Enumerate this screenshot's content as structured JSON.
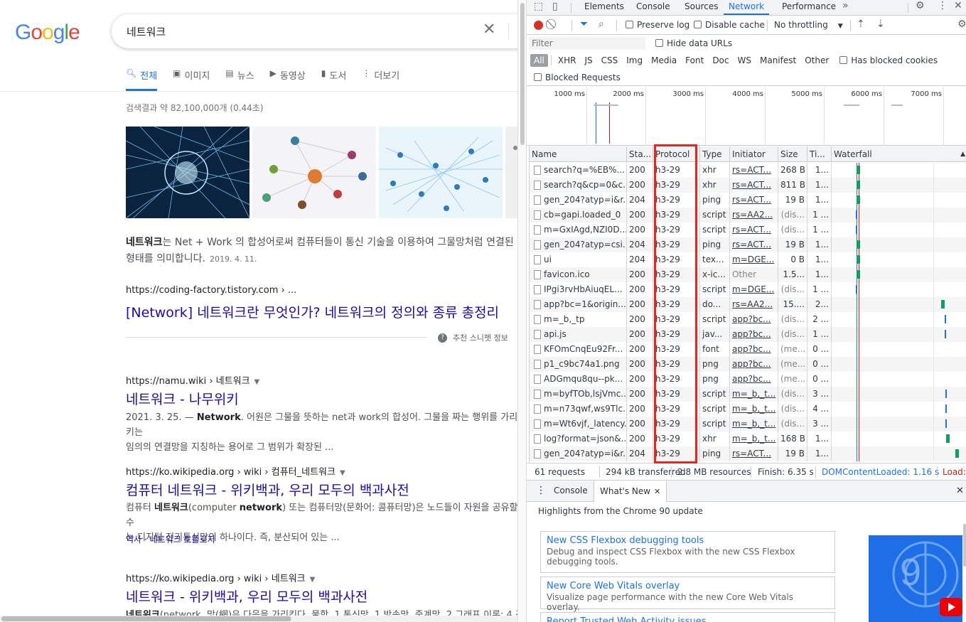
{
  "google": {
    "search": {
      "query": "네트워크"
    },
    "tabs": [
      {
        "icon": "search-icon",
        "label": "전체",
        "active": true
      },
      {
        "icon": "image-icon",
        "label": "이미지"
      },
      {
        "icon": "news-icon",
        "label": "뉴스"
      },
      {
        "icon": "video-icon",
        "label": "동영상"
      },
      {
        "icon": "book-icon",
        "label": "도서"
      },
      {
        "icon": "more-icon",
        "label": "더보기"
      }
    ],
    "stats": "검색결과 약 82,100,000개 (0.44초)",
    "snippet": {
      "bold": "네트워크",
      "text1": "는 Net + Work 의 합성어로써 컴퓨터들이 통신 기술을 이용하여 그물망처럼 연결된",
      "text2": "형태를 의미합니다.",
      "date": "2019. 4. 11.",
      "cite": "https://coding-factory.tistory.com › ...",
      "title": "[Network] 네트워크란 무엇인가? 네트워크의 정의와 종류 총정리",
      "feedback": "추천 스니펫 정보"
    },
    "results": [
      {
        "cite": "https://namu.wiki › 네트워크",
        "title": "네트워크 - 나무위키",
        "desc1_pre": "2021. 3. 25. — ",
        "desc1_bold": "Network",
        "desc1_post": ". 어원은 그물을 뜻하는 net과 work의 합성어. 그물을 짜는 행위를 가리키는",
        "desc2": "임의의 연결망을 지칭하는 용어로 그 범위가 확장된 ..."
      },
      {
        "cite": "https://ko.wikipedia.org › wiki › 컴퓨터_네트워크",
        "title": "컴퓨터 네트워크 - 위키백과, 우리 모두의 백과사전",
        "desc1_pre": "컴퓨터 ",
        "desc1_bold": "네트워크",
        "desc1_mid": "(computer ",
        "desc1_bold2": "network",
        "desc1_post": ") 또는 컴퓨터망(문화어: 콤퓨터망)은 노드들이 자원을 공유할 수",
        "desc2": "는 디지털 전기통신망의 하나이다. 즉, 분산되어 있는 ...",
        "sublinks": "역사 · 네트워크 토폴로지"
      },
      {
        "cite": "https://ko.wikipedia.org › wiki › 네트워크",
        "title": "네트워크 - 위키백과, 우리 모두의 백과사전",
        "desc1_bold": "네트워크",
        "desc1_post": "(network, 망(網)은 다음을 가리킨다. 물학, 1 통신망, 1 방송망, 중계망, 2 그래프 이론: 4 경"
      }
    ]
  },
  "devtools": {
    "tabs": [
      "Elements",
      "Console",
      "Sources",
      "Network",
      "Performance"
    ],
    "active_tab": "Network",
    "toolbar": {
      "preserve_log": "Preserve log",
      "disable_cache": "Disable cache",
      "throttling": "No throttling"
    },
    "filter": {
      "placeholder": "Filter",
      "hide_data_urls": "Hide data URLs",
      "blocked_requests": "Blocked Requests",
      "has_blocked_cookies": "Has blocked cookies"
    },
    "filter_types": [
      "All",
      "XHR",
      "JS",
      "CSS",
      "Img",
      "Media",
      "Font",
      "Doc",
      "WS",
      "Manifest",
      "Other"
    ],
    "timeline_ticks": [
      "1000 ms",
      "2000 ms",
      "3000 ms",
      "4000 ms",
      "5000 ms",
      "6000 ms",
      "7000 ms"
    ],
    "columns": [
      "Name",
      "Sta...",
      "Protocol",
      "Type",
      "Initiator",
      "Size",
      "Ti...",
      "Waterfall"
    ],
    "rows": [
      {
        "name": "search?q=%EB%...",
        "status": "200",
        "protocol": "h3-29",
        "type": "xhr",
        "initiator": "rs=ACT...",
        "size": "268 B",
        "time": "1...",
        "wf": 0.19,
        "color": "#0fa061"
      },
      {
        "name": "search?q&cp=0&c...",
        "status": "200",
        "protocol": "h3-29",
        "type": "xhr",
        "initiator": "rs=ACT...",
        "size": "811 B",
        "time": "1...",
        "wf": 0.19,
        "color": "#0fa061"
      },
      {
        "name": "gen_204?atyp=i&r...",
        "status": "204",
        "protocol": "h3-29",
        "type": "ping",
        "initiator": "rs=ACT...",
        "size": "19 B",
        "time": "1...",
        "wf": 0.19,
        "color": "#0fa061"
      },
      {
        "name": "cb=gapi.loaded_0",
        "status": "200",
        "protocol": "h3-29",
        "type": "script",
        "initiator": "rs=AA2...",
        "size": "(dis...",
        "time": "1 ...",
        "wf": 0.185,
        "color": "#1a73e8"
      },
      {
        "name": "m=GxIAgd,NZI0D...",
        "status": "200",
        "protocol": "h3-29",
        "type": "script",
        "initiator": "rs=ACT...",
        "size": "(dis...",
        "time": "1 ...",
        "wf": 0.185,
        "color": "#1a73e8"
      },
      {
        "name": "gen_204?atyp=csi...",
        "status": "204",
        "protocol": "h3-29",
        "type": "ping",
        "initiator": "rs=ACT...",
        "size": "19 B",
        "time": "1...",
        "wf": 0.19,
        "color": "#0fa061"
      },
      {
        "name": "ui",
        "status": "204",
        "protocol": "h3-29",
        "type": "tex...",
        "initiator": "m=DGE...",
        "size": "0 B",
        "time": "1...",
        "wf": 0.19,
        "color": "#0fa061"
      },
      {
        "name": "favicon.ico",
        "status": "200",
        "protocol": "h3-29",
        "type": "x-ic...",
        "initiator": "Other",
        "size": "1.5...",
        "time": "1...",
        "wf": 0.19,
        "color": "#0fa061"
      },
      {
        "name": "IPgi3rvHbAiuqEL...",
        "status": "200",
        "protocol": "h3-29",
        "type": "script",
        "initiator": "m=DGE...",
        "size": "(dis...",
        "time": "1 ...",
        "wf": 0.185,
        "color": "#1a73e8"
      },
      {
        "name": "app?bc=1&origin...",
        "status": "200",
        "protocol": "h3-29",
        "type": "do...",
        "initiator": "rs=AA2...",
        "size": "15....",
        "time": "2...",
        "wf": 0.83,
        "color": "#0fa061"
      },
      {
        "name": "m=_b,_tp",
        "status": "200",
        "protocol": "h3-29",
        "type": "script",
        "initiator": "app?bc...",
        "size": "(dis...",
        "time": "2 ...",
        "wf": 0.855,
        "color": "#1a73e8"
      },
      {
        "name": "api.js",
        "status": "200",
        "protocol": "h3-29",
        "type": "jav...",
        "initiator": "app?bc...",
        "size": "(dis...",
        "time": "1 ...",
        "wf": 0.855,
        "color": "#1a73e8"
      },
      {
        "name": "KFOmCnqEu92Fr...",
        "status": "200",
        "protocol": "h3-29",
        "type": "font",
        "initiator": "app?bc...",
        "size": "(me...",
        "time": "0 ...",
        "wf": null,
        "color": ""
      },
      {
        "name": "p1_c9bc74a1.png",
        "status": "200",
        "protocol": "h3-29",
        "type": "png",
        "initiator": "app?bc...",
        "size": "(me...",
        "time": "0 ...",
        "wf": null,
        "color": ""
      },
      {
        "name": "ADGmqu8qu--pk...",
        "status": "200",
        "protocol": "h3-29",
        "type": "png",
        "initiator": "app?bc...",
        "size": "(me...",
        "time": "0 ...",
        "wf": null,
        "color": ""
      },
      {
        "name": "m=byfTOb,lsjVmc...",
        "status": "200",
        "protocol": "h3-29",
        "type": "script",
        "initiator": "m=_b,_t...",
        "size": "(dis...",
        "time": "3 ...",
        "wf": 0.86,
        "color": "#1a73e8"
      },
      {
        "name": "m=n73qwf,ws9Tlc...",
        "status": "200",
        "protocol": "h3-29",
        "type": "script",
        "initiator": "m=_b,_t...",
        "size": "(dis...",
        "time": "4 ...",
        "wf": 0.86,
        "color": "#1a73e8"
      },
      {
        "name": "m=Wt6vjf,_latency...",
        "status": "200",
        "protocol": "h3-29",
        "type": "script",
        "initiator": "m=_b,_t...",
        "size": "(dis...",
        "time": "3 ...",
        "wf": 0.86,
        "color": "#1a73e8"
      },
      {
        "name": "log?format=json&...",
        "status": "200",
        "protocol": "h3-29",
        "type": "xhr",
        "initiator": "m=_b,_t...",
        "size": "168 B",
        "time": "1...",
        "wf": 0.865,
        "color": "#0fa061"
      },
      {
        "name": "gen_204?atyp=i&r...",
        "status": "204",
        "protocol": "h3-29",
        "type": "ping",
        "initiator": "rs=ACT...",
        "size": "19 B",
        "time": "1...",
        "wf": 0.935,
        "color": "#0fa061"
      }
    ],
    "status": {
      "requests": "61 requests",
      "transferred": "294 kB transferred",
      "resources": "2.8 MB resources",
      "finish": "Finish: 6.35 s",
      "domcontentloaded": "DOMContentLoaded: 1.16 s",
      "load": "Load:"
    },
    "drawer": {
      "tabs": [
        "Console",
        "What's New"
      ],
      "active": "What's New",
      "highlight": "Highlights from the Chrome 90 update",
      "cards": [
        {
          "title": "New CSS Flexbox debugging tools",
          "desc": "Debug and inspect CSS Flexbox with the new CSS Flexbox debugging tools."
        },
        {
          "title": "New Core Web Vitals overlay",
          "desc": "Visualize page performance with the new Core Web Vitals overlay."
        },
        {
          "title": "Report Trusted Web Activity issues",
          "desc": ""
        }
      ]
    },
    "colors": {
      "accent": "#1a73e8",
      "record": "#d93025",
      "highlight_box": "#e8261f",
      "green": "#0fa061"
    }
  }
}
